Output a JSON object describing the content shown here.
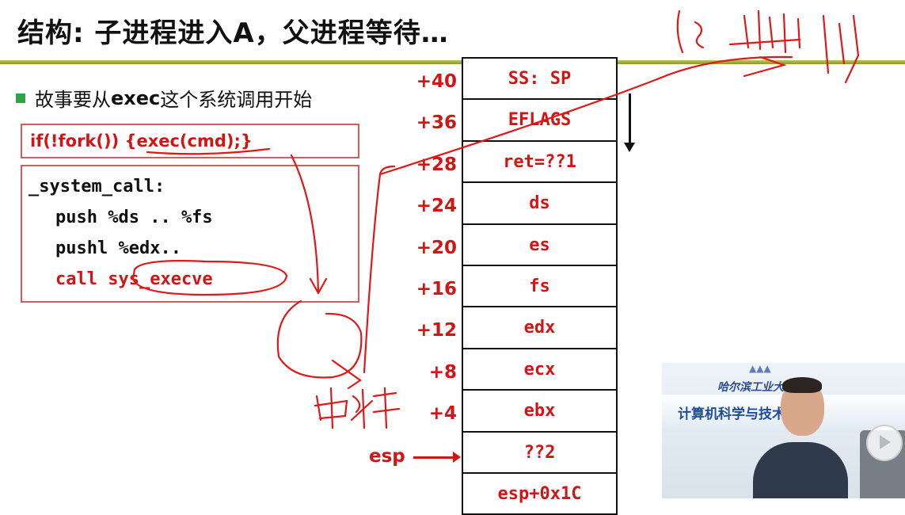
{
  "slide": {
    "title": "结构: 子进程进入A，父进程等待…",
    "bullet_prefix": "故事要从",
    "bullet_bold": "exec",
    "bullet_suffix": "这个系统调用开始",
    "fork_code": "if(!fork()) {exec(cmd);}",
    "code": {
      "line1": "_system_call:",
      "line2": "push %ds .. %fs",
      "line3": "pushl %edx..",
      "line4": "call sys_execve"
    },
    "offsets": [
      "+40",
      "+36",
      "+28",
      "+24",
      "+20",
      "+16",
      "+12",
      "+8",
      "+4"
    ],
    "stack_cells": [
      "SS: SP",
      "EFLAGS",
      "ret=??1",
      "ds",
      "es",
      "fs",
      "edx",
      "ecx",
      "ebx",
      "??2",
      "esp+0x1C"
    ],
    "esp_label": "esp"
  },
  "annotations": {
    "handwritten_note": "中断"
  },
  "video": {
    "university_text": "哈尔滨工业大学",
    "department_text": "计算机科学与技术学院"
  },
  "colors": {
    "accent_red": "#d41414",
    "bullet_green": "#2ea34a",
    "rule_olive": "#a3ad3c"
  }
}
